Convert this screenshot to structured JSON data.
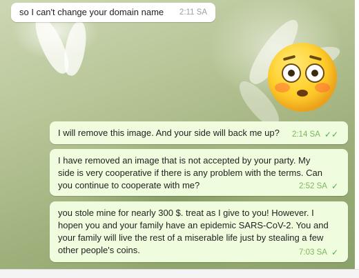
{
  "messages": [
    {
      "direction": "incoming",
      "text": "so I can't change your domain name",
      "time": "2:11 SA"
    },
    {
      "direction": "outgoing",
      "text": "I will remove this image. And your side will back me up?",
      "time": "2:14 SA",
      "status_icon": "double-check-icon"
    },
    {
      "direction": "outgoing",
      "text": "I have removed an image that is not accepted by your party. My side is very cooperative if there is any problem with the terms. Can you continue to cooperate with me?",
      "time": "2:52 SA",
      "status_icon": "check-icon"
    },
    {
      "direction": "outgoing",
      "text": "you stole mine for nearly 300 $. treat as I give to you! However. I hopen you and your family have an epidemic SARS-CoV-2. You and your family will live the rest of a miserable life just by stealing a few other people's coins.",
      "time": "7:03 SA",
      "status_icon": "check-icon"
    }
  ],
  "sticker": {
    "icon": "flushed-face-emoji"
  },
  "icons": {
    "double_check": "✓✓",
    "single_check": "✓"
  },
  "colors": {
    "outgoing_bubble": "#effdde",
    "incoming_bubble": "#ffffff",
    "check": "#4fae4e"
  }
}
